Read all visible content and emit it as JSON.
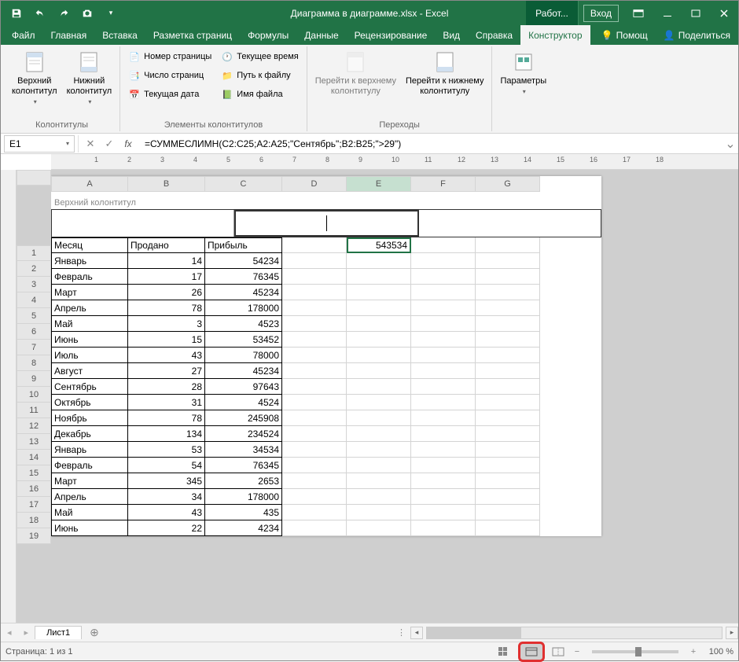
{
  "title": {
    "filename": "Диаграмма в диаграмме.xlsx",
    "app": "Excel",
    "full": "Диаграмма в диаграмме.xlsx  -  Excel"
  },
  "titlebar": {
    "mode": "Работ...",
    "login": "Вход"
  },
  "tabs": [
    "Файл",
    "Главная",
    "Вставка",
    "Разметка страниц",
    "Формулы",
    "Данные",
    "Рецензирование",
    "Вид",
    "Справка",
    "Конструктор"
  ],
  "tabs_active": "Конструктор",
  "tabs_right": {
    "help": "Помощ",
    "share": "Поделиться"
  },
  "ribbon": {
    "g1": {
      "label": "Колонтитулы",
      "btn1": "Верхний\nколонтитул",
      "btn2": "Нижний\nколонтитул"
    },
    "g2": {
      "label": "Элементы колонтитулов",
      "b1": "Номер страницы",
      "b2": "Число страниц",
      "b3": "Текущая дата",
      "b4": "Текущее время",
      "b5": "Путь к файлу",
      "b6": "Имя файла"
    },
    "g3": {
      "label": "Переходы",
      "btn1": "Перейти к верхнему\nколонтитулу",
      "btn2": "Перейти к нижнему\nколонтитулу"
    },
    "g4": {
      "btn": "Параметры"
    }
  },
  "formulabar": {
    "cell": "E1",
    "formula": "=СУММЕСЛИМН(C2:C25;A2:A25;\"Сентябрь\";B2:B25;\">29\")"
  },
  "ruler_nums": [
    1,
    2,
    3,
    4,
    5,
    6,
    7,
    8,
    9,
    10,
    11,
    12,
    13,
    14,
    15,
    16,
    17,
    18
  ],
  "columns": [
    "A",
    "B",
    "C",
    "D",
    "E",
    "F",
    "G"
  ],
  "header_label": "Верхний колонтитул",
  "data_header": [
    "Месяц",
    "Продано",
    "Прибыль"
  ],
  "selected_value": "543534",
  "rows": [
    {
      "n": 1,
      "a": "Месяц",
      "b": "Продано",
      "c": "Прибыль"
    },
    {
      "n": 2,
      "a": "Январь",
      "b": 14,
      "c": 54234
    },
    {
      "n": 3,
      "a": "Февраль",
      "b": 17,
      "c": 76345
    },
    {
      "n": 4,
      "a": "Март",
      "b": 26,
      "c": 45234
    },
    {
      "n": 5,
      "a": "Апрель",
      "b": 78,
      "c": 178000
    },
    {
      "n": 6,
      "a": "Май",
      "b": 3,
      "c": 4523
    },
    {
      "n": 7,
      "a": "Июнь",
      "b": 15,
      "c": 53452
    },
    {
      "n": 8,
      "a": "Июль",
      "b": 43,
      "c": 78000
    },
    {
      "n": 9,
      "a": "Август",
      "b": 27,
      "c": 45234
    },
    {
      "n": 10,
      "a": "Сентябрь",
      "b": 28,
      "c": 97643
    },
    {
      "n": 11,
      "a": "Октябрь",
      "b": 31,
      "c": 4524
    },
    {
      "n": 12,
      "a": "Ноябрь",
      "b": 78,
      "c": 245908
    },
    {
      "n": 13,
      "a": "Декабрь",
      "b": 134,
      "c": 234524
    },
    {
      "n": 14,
      "a": "Январь",
      "b": 53,
      "c": 34534
    },
    {
      "n": 15,
      "a": "Февраль",
      "b": 54,
      "c": 76345
    },
    {
      "n": 16,
      "a": "Март",
      "b": 345,
      "c": 2653
    },
    {
      "n": 17,
      "a": "Апрель",
      "b": 34,
      "c": 178000
    },
    {
      "n": 18,
      "a": "Май",
      "b": 43,
      "c": 435
    },
    {
      "n": 19,
      "a": "Июнь",
      "b": 22,
      "c": 4234
    }
  ],
  "sheettab": "Лист1",
  "statusbar": {
    "page": "Страница: 1 из 1",
    "zoom": "100 %"
  },
  "chart_data": {
    "type": "table",
    "columns": [
      "Месяц",
      "Продано",
      "Прибыль"
    ],
    "rows": [
      [
        "Январь",
        14,
        54234
      ],
      [
        "Февраль",
        17,
        76345
      ],
      [
        "Март",
        26,
        45234
      ],
      [
        "Апрель",
        78,
        178000
      ],
      [
        "Май",
        3,
        4523
      ],
      [
        "Июнь",
        15,
        53452
      ],
      [
        "Июль",
        43,
        78000
      ],
      [
        "Август",
        27,
        45234
      ],
      [
        "Сентябрь",
        28,
        97643
      ],
      [
        "Октябрь",
        31,
        4524
      ],
      [
        "Ноябрь",
        78,
        245908
      ],
      [
        "Декабрь",
        134,
        234524
      ],
      [
        "Январь",
        53,
        34534
      ],
      [
        "Февраль",
        54,
        76345
      ],
      [
        "Март",
        345,
        2653
      ],
      [
        "Апрель",
        34,
        178000
      ],
      [
        "Май",
        43,
        435
      ],
      [
        "Июнь",
        22,
        4234
      ]
    ]
  }
}
